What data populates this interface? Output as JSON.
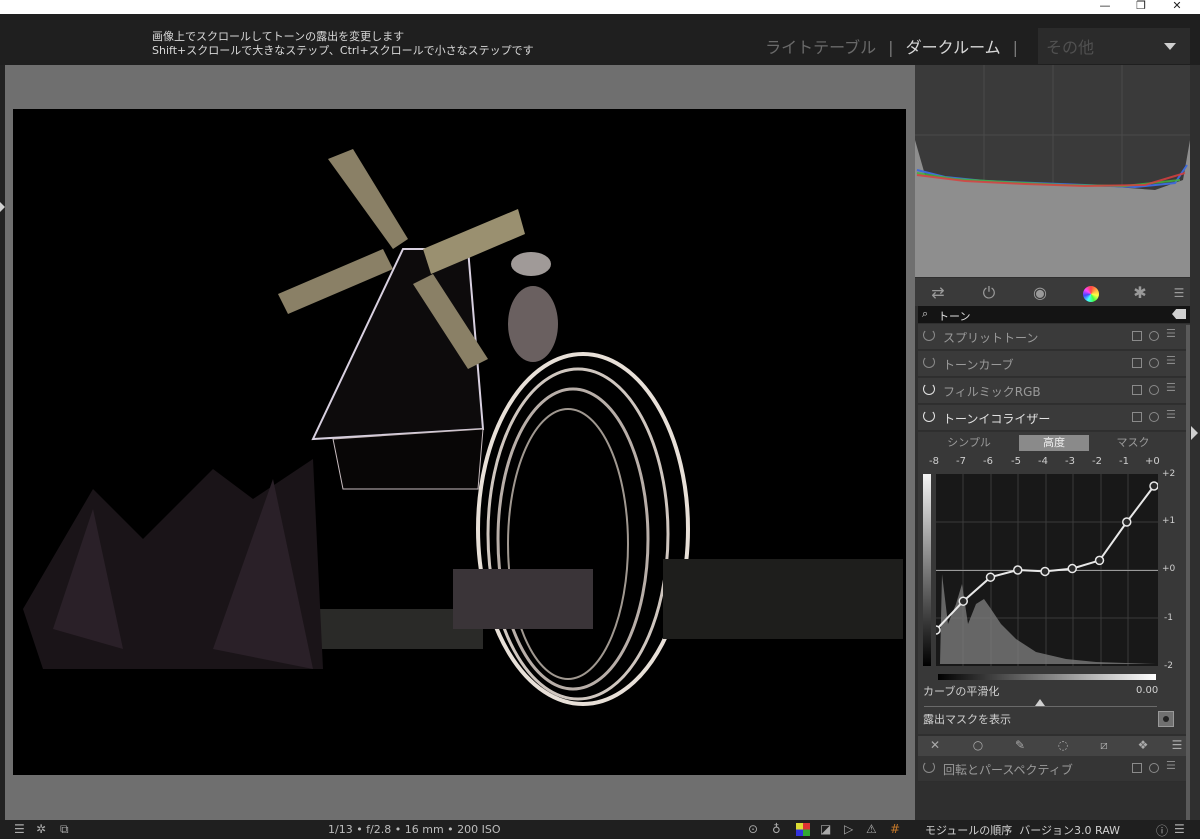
{
  "window": {
    "minimize": "—",
    "restore": "❐",
    "close": "✕"
  },
  "header": {
    "hint_line1": "画像上でスクロールしてトーンの露出を変更します",
    "hint_line2": "Shift+スクロールで大きなステップ、Ctrl+スクロールで小さなステップです",
    "views": [
      {
        "label": "ライトテーブル"
      },
      {
        "label": "ダークルーム"
      },
      {
        "label": "その他"
      }
    ],
    "active_view": "ダークルーム",
    "separator": "|"
  },
  "module_tabs": [
    {
      "icon": "sliders-icon"
    },
    {
      "icon": "power-icon"
    },
    {
      "icon": "aperture-icon"
    },
    {
      "icon": "color-wheel-icon"
    },
    {
      "icon": "effects-icon"
    },
    {
      "icon": "hamburger-icon"
    }
  ],
  "search": {
    "value": "トーン"
  },
  "modules": [
    {
      "name": "スプリットトーン",
      "enabled": false
    },
    {
      "name": "トーンカーブ",
      "enabled": false
    },
    {
      "name": "フィルミックRGB",
      "enabled": true
    },
    {
      "name": "トーンイコライザー",
      "enabled": true
    },
    {
      "name": "回転とパースペクティブ",
      "enabled": false
    }
  ],
  "tone_equalizer": {
    "tabs": [
      "シンプル",
      "高度",
      "マスク"
    ],
    "selected_tab": "高度",
    "ev_labels": [
      "-8",
      "-7",
      "-6",
      "-5",
      "-4",
      "-3",
      "-2",
      "-1",
      "+0"
    ],
    "y_labels": [
      "+2",
      "+1",
      "+0",
      "-1",
      "-2"
    ],
    "curve_ev": [
      -8,
      -7,
      -6,
      -5,
      -4,
      -3,
      -2,
      -1,
      0
    ],
    "curve_values": [
      -1.25,
      -0.65,
      -0.15,
      0.0,
      -0.03,
      0.03,
      0.2,
      1.0,
      1.75
    ],
    "smoothing_label": "カーブの平滑化",
    "smoothing_value": "0.00",
    "show_mask_label": "露出マスクを表示"
  },
  "footer": {
    "exif": "1/13 • f/2.8 • 16 mm • 200 ISO",
    "module_order_label": "モジュールの順序",
    "module_order_value": "バージョン3.0 RAW"
  },
  "colors": {
    "accent_text": "#e0e0e0",
    "panel": "#3a3a3a",
    "canvas": "#6f6f6f"
  }
}
